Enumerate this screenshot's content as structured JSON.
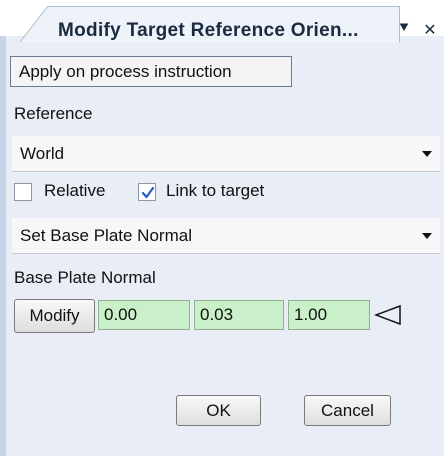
{
  "window": {
    "title": "Modify Target Reference Orien...",
    "menu_glyph": "⯆",
    "close_glyph": "✕"
  },
  "apply_button": "Apply on process instruction",
  "reference": {
    "label": "Reference",
    "selected": "World"
  },
  "options": {
    "relative_label": "Relative",
    "relative_checked": false,
    "link_label": "Link to target",
    "link_checked": true
  },
  "mode": {
    "selected": "Set Base Plate Normal"
  },
  "vector": {
    "label": "Base Plate Normal",
    "modify_label": "Modify",
    "x": "0.00",
    "y": "0.03",
    "z": "1.00",
    "pick_icon": "triangle-left-icon"
  },
  "footer": {
    "ok_label": "OK",
    "cancel_label": "Cancel"
  },
  "colors": {
    "field_bg": "#c9f0c9",
    "panel_bg": "#e9eef6",
    "check_mark": "#1f5fbf"
  }
}
